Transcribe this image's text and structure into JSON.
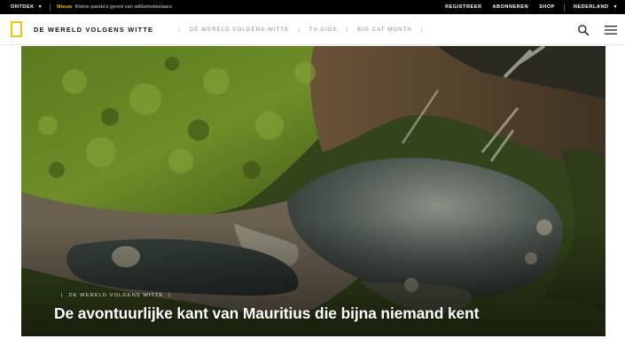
{
  "topbar": {
    "explore_label": "ONTDEK",
    "news_tag": "Nieuw",
    "news_text": "Kleine panda's gered van wildsmokkelaars",
    "links": [
      "REGISTREER",
      "ABONNEREN",
      "SHOP"
    ],
    "language": "NEDERLAND"
  },
  "header": {
    "brand": "DE WERELD VOLGENS WITTE",
    "nav": [
      "DE WERELD VOLGENS WITTE",
      "TV-GIDS",
      "BIG CAT MONTH"
    ]
  },
  "hero": {
    "kicker": "DE WERELD VOLGENS WITTE",
    "title": "De avontuurlijke kant van Mauritius die bijna niemand kent"
  },
  "icons": {
    "logo": "yellow-border-logo-icon",
    "search": "search-icon",
    "menu": "hamburger-menu-icon",
    "chevron": "chevron-down-icon"
  },
  "colors": {
    "topbar_bg": "#000000",
    "news_tag": "#f5c400",
    "logo_yellow": "#f8c200",
    "brand_text": "#111111",
    "nav_text": "#8a8a8a"
  }
}
